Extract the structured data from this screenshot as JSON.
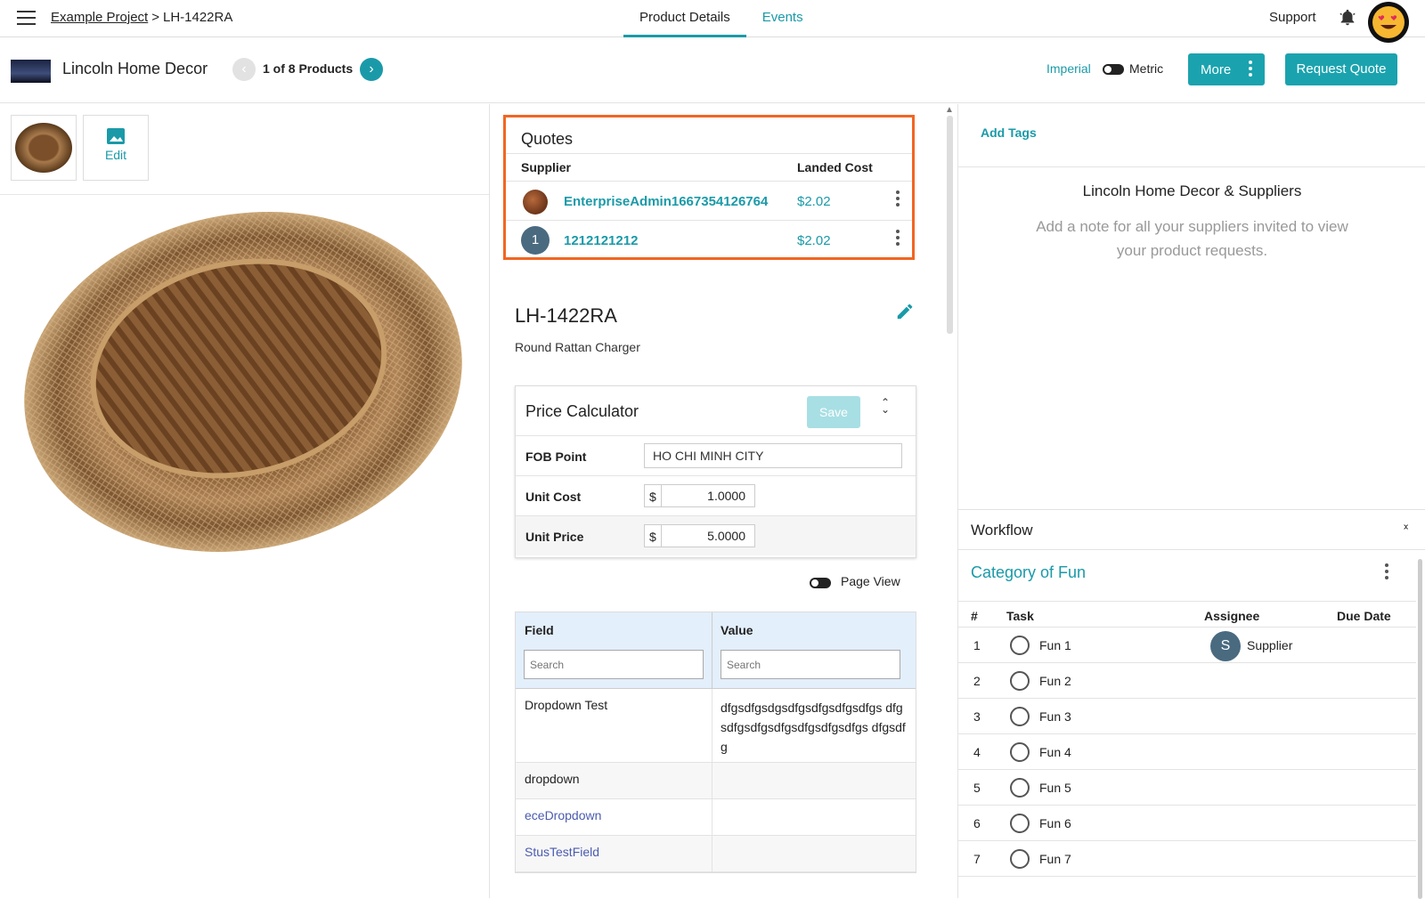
{
  "header": {
    "breadcrumb_project": "Example Project",
    "breadcrumb_sep": ">",
    "breadcrumb_item": "LH-1422RA",
    "tabs": [
      {
        "label": "Product Details"
      },
      {
        "label": "Events"
      }
    ],
    "support": "Support"
  },
  "subheader": {
    "company": "Lincoln Home Decor",
    "pager": "1 of 8 Products",
    "prev_icon": "‹",
    "next_icon": "›",
    "unit_imperial": "Imperial",
    "unit_metric": "Metric",
    "more_label": "More",
    "request_quote_label": "Request Quote"
  },
  "gallery": {
    "edit_label": "Edit"
  },
  "quotes": {
    "title": "Quotes",
    "col_supplier": "Supplier",
    "col_landed_cost": "Landed Cost",
    "rows": [
      {
        "supplier": "EnterpriseAdmin1667354126764",
        "cost": "$2.02",
        "avatar": ""
      },
      {
        "supplier": "1212121212",
        "cost": "$2.02",
        "avatar": "1"
      }
    ]
  },
  "product": {
    "id": "LH-1422RA",
    "description": "Round Rattan Charger"
  },
  "calculator": {
    "title": "Price Calculator",
    "save_label": "Save",
    "fob_label": "FOB Point",
    "fob_value": "HO CHI MINH CITY",
    "unit_cost_label": "Unit Cost",
    "unit_cost_value": "1.0000",
    "unit_price_label": "Unit Price",
    "unit_price_value": "5.0000",
    "currency": "$"
  },
  "page_view_label": "Page View",
  "fields": {
    "col_field": "Field",
    "col_value": "Value",
    "search_placeholder": "Search",
    "rows": [
      {
        "name": "Dropdown Test",
        "value": "dfgsdfgsdgsdfgsdfgsdfgsdfgs dfgsdfgsdfgsdfgsdfgsdfgsdfgs dfgsdfg"
      },
      {
        "name": "dropdown",
        "value": ""
      },
      {
        "name": "eceDropdown",
        "value": ""
      },
      {
        "name": "StusTestField",
        "value": ""
      }
    ]
  },
  "right": {
    "add_tags": "Add Tags",
    "note_title": "Lincoln Home Decor & Suppliers",
    "note_text": "Add a note for all your suppliers invited to view your product requests."
  },
  "workflow": {
    "title": "Workflow",
    "category": "Category of Fun",
    "col_num": "#",
    "col_task": "Task",
    "col_assignee": "Assignee",
    "col_due": "Due Date",
    "tasks": [
      {
        "n": "1",
        "task": "Fun 1",
        "assignee": "Supplier",
        "initial": "S"
      },
      {
        "n": "2",
        "task": "Fun 2"
      },
      {
        "n": "3",
        "task": "Fun 3"
      },
      {
        "n": "4",
        "task": "Fun 4"
      },
      {
        "n": "5",
        "task": "Fun 5"
      },
      {
        "n": "6",
        "task": "Fun 6"
      },
      {
        "n": "7",
        "task": "Fun 7"
      }
    ]
  },
  "colors": {
    "accent": "#1a9aa8",
    "highlight_border": "#f26522",
    "link_purple": "#4a5bb0"
  }
}
